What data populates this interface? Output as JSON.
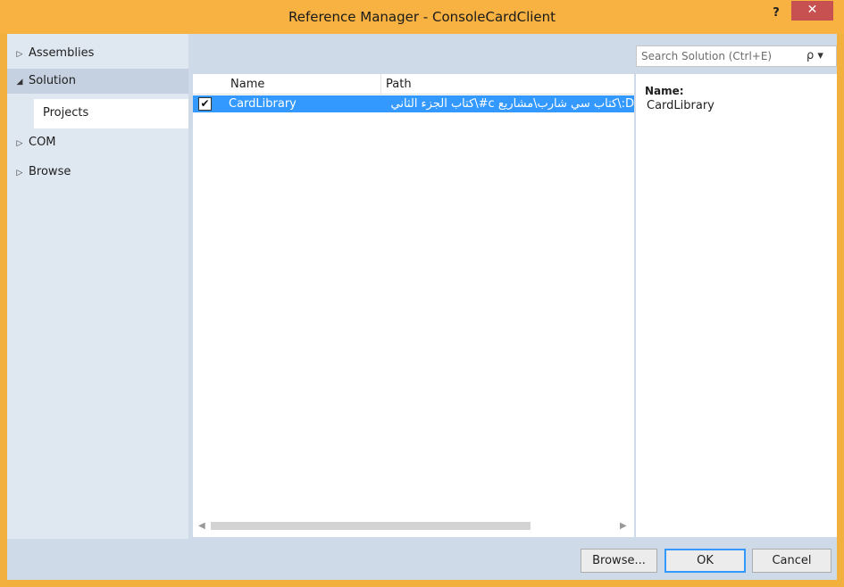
{
  "window": {
    "title": "Reference Manager - ConsoleCardClient",
    "help": "?",
    "close": "✕"
  },
  "nav": {
    "items": [
      {
        "label": "Assemblies",
        "arrow": "▷"
      },
      {
        "label": "Solution",
        "arrow": "◢"
      },
      {
        "label": "COM",
        "arrow": "▷"
      },
      {
        "label": "Browse",
        "arrow": "▷"
      }
    ],
    "sub_item": "Projects"
  },
  "search": {
    "placeholder": "Search Solution (Ctrl+E)",
    "icon": "ρ ▾"
  },
  "list": {
    "columns": [
      "Name",
      "Path"
    ],
    "rows": [
      {
        "checked": true,
        "name": "CardLibrary",
        "path": "D:\\كتاب سي شارب\\مشاريع c#\\كتاب الجزء الثاني"
      }
    ]
  },
  "details": {
    "label": "Name:",
    "value": "CardLibrary"
  },
  "buttons": {
    "browse": "Browse...",
    "ok": "OK",
    "cancel": "Cancel"
  },
  "colors": {
    "titlebar": "#f7b241",
    "selection": "#3399ff",
    "close": "#c75050",
    "client": "#cfdae8"
  }
}
